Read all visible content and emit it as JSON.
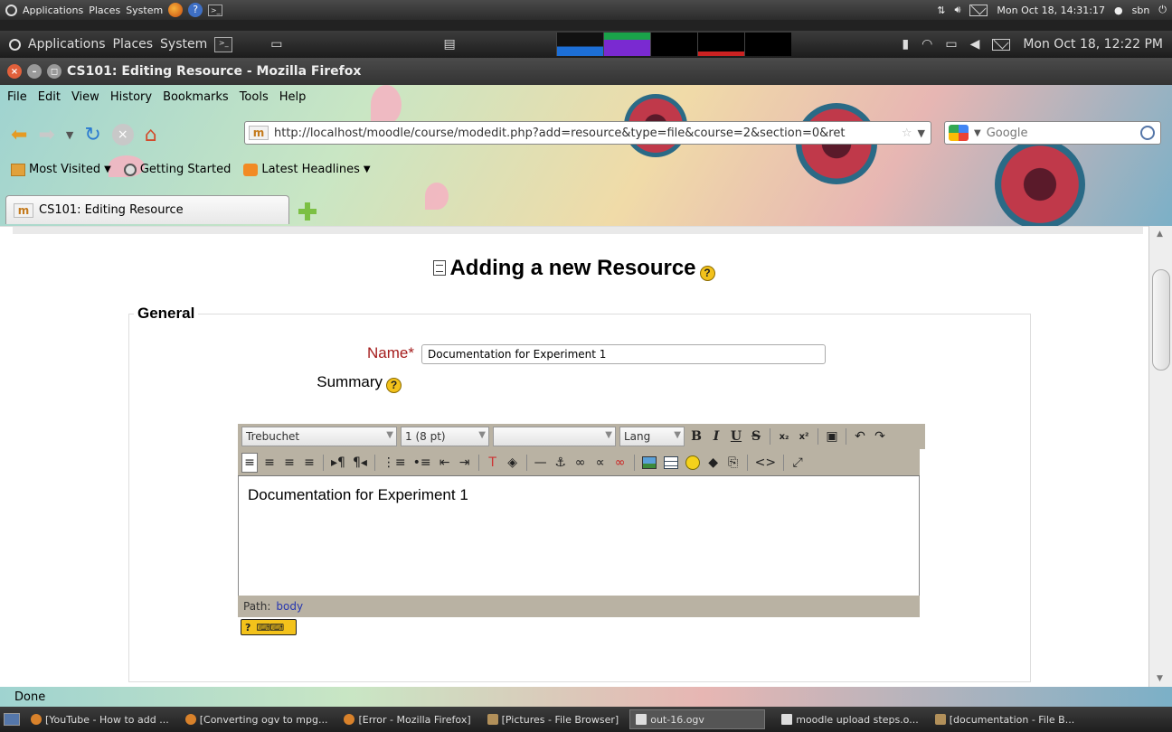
{
  "host_panel": {
    "menus": [
      "Applications",
      "Places",
      "System"
    ],
    "datetime": "Mon Oct 18, 14:31:17",
    "user": "sbn"
  },
  "guest_panel": {
    "menus": [
      "Applications",
      "Places",
      "System"
    ],
    "datetime": "Mon Oct 18, 12:22 PM"
  },
  "window": {
    "title": "CS101: Editing Resource - Mozilla Firefox"
  },
  "menubar": [
    {
      "label": "File"
    },
    {
      "label": "Edit"
    },
    {
      "label": "View"
    },
    {
      "label": "History"
    },
    {
      "label": "Bookmarks"
    },
    {
      "label": "Tools"
    },
    {
      "label": "Help"
    }
  ],
  "navbar": {
    "url": "http://localhost/moodle/course/modedit.php?add=resource&type=file&course=2&section=0&ret",
    "search_placeholder": "Google"
  },
  "bookmarks": [
    {
      "label": "Most Visited",
      "icon": "folder-icon"
    },
    {
      "label": "Getting Started",
      "icon": "getting-started-icon"
    },
    {
      "label": "Latest Headlines",
      "icon": "rss-icon"
    }
  ],
  "tab": {
    "label": "CS101: Editing Resource"
  },
  "page": {
    "heading": "Adding a new Resource",
    "section_legend": "General",
    "name_label": "Name*",
    "name_value": "Documentation for Experiment 1",
    "summary_label": "Summary",
    "help_glyph": "?"
  },
  "editor": {
    "font_family": "Trebuchet",
    "font_size": "1 (8 pt)",
    "style_select": "",
    "lang_label": "Lang",
    "content": "Documentation for Experiment 1",
    "path_label": "Path:",
    "path_value": "body"
  },
  "status": {
    "text": "Done"
  },
  "taskbar": {
    "items": [
      {
        "label": "[YouTube - How to add ...",
        "icon": "firefox"
      },
      {
        "label": "[Converting ogv to mpg...",
        "icon": "firefox"
      },
      {
        "label": "[Error - Mozilla Firefox]",
        "icon": "firefox"
      },
      {
        "label": "[Pictures - File Browser]",
        "icon": "folder"
      },
      {
        "label": "out-16.ogv",
        "icon": "video",
        "active": true
      },
      {
        "label": "moodle upload steps.o...",
        "icon": "doc"
      },
      {
        "label": "[documentation - File B...",
        "icon": "folder"
      }
    ]
  }
}
